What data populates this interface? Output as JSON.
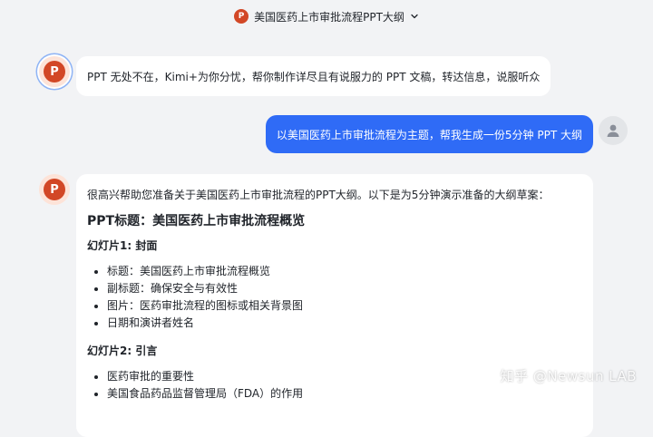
{
  "header": {
    "title": "美国医药上市审批流程PPT大纲",
    "icon": "ppt-icon",
    "icon_letter": "P"
  },
  "messages": {
    "bot_greeting": "PPT 无处不在，Kimi+为你分忧，帮你制作详尽且有说服力的 PPT 文稿，转达信息，说服听众",
    "user_request": "以美国医药上市审批流程为主题，帮我生成一份5分钟 PPT 大纲",
    "bot_reply": {
      "intro": "很高兴帮助您准备关于美国医药上市审批流程的PPT大纲。以下是为5分钟演示准备的大纲草案：",
      "ppt_title": "PPT标题：美国医药上市审批流程概览",
      "slides": [
        {
          "heading": "幻灯片1: 封面",
          "bullets": [
            "标题：美国医药上市审批流程概览",
            "副标题：确保安全与有效性",
            "图片：医药审批流程的图标或相关背景图",
            "日期和演讲者姓名"
          ]
        },
        {
          "heading": "幻灯片2: 引言",
          "bullets": [
            "医药审批的重要性",
            "美国食品药品监督管理局（FDA）的作用"
          ]
        }
      ]
    }
  },
  "watermark": "知乎 @Newsun LAB",
  "colors": {
    "background": "#f2f3f5",
    "user_bubble": "#2f6bf6",
    "ppt_brand": "#d24726",
    "avatar_ring": "#8fb4f5"
  }
}
